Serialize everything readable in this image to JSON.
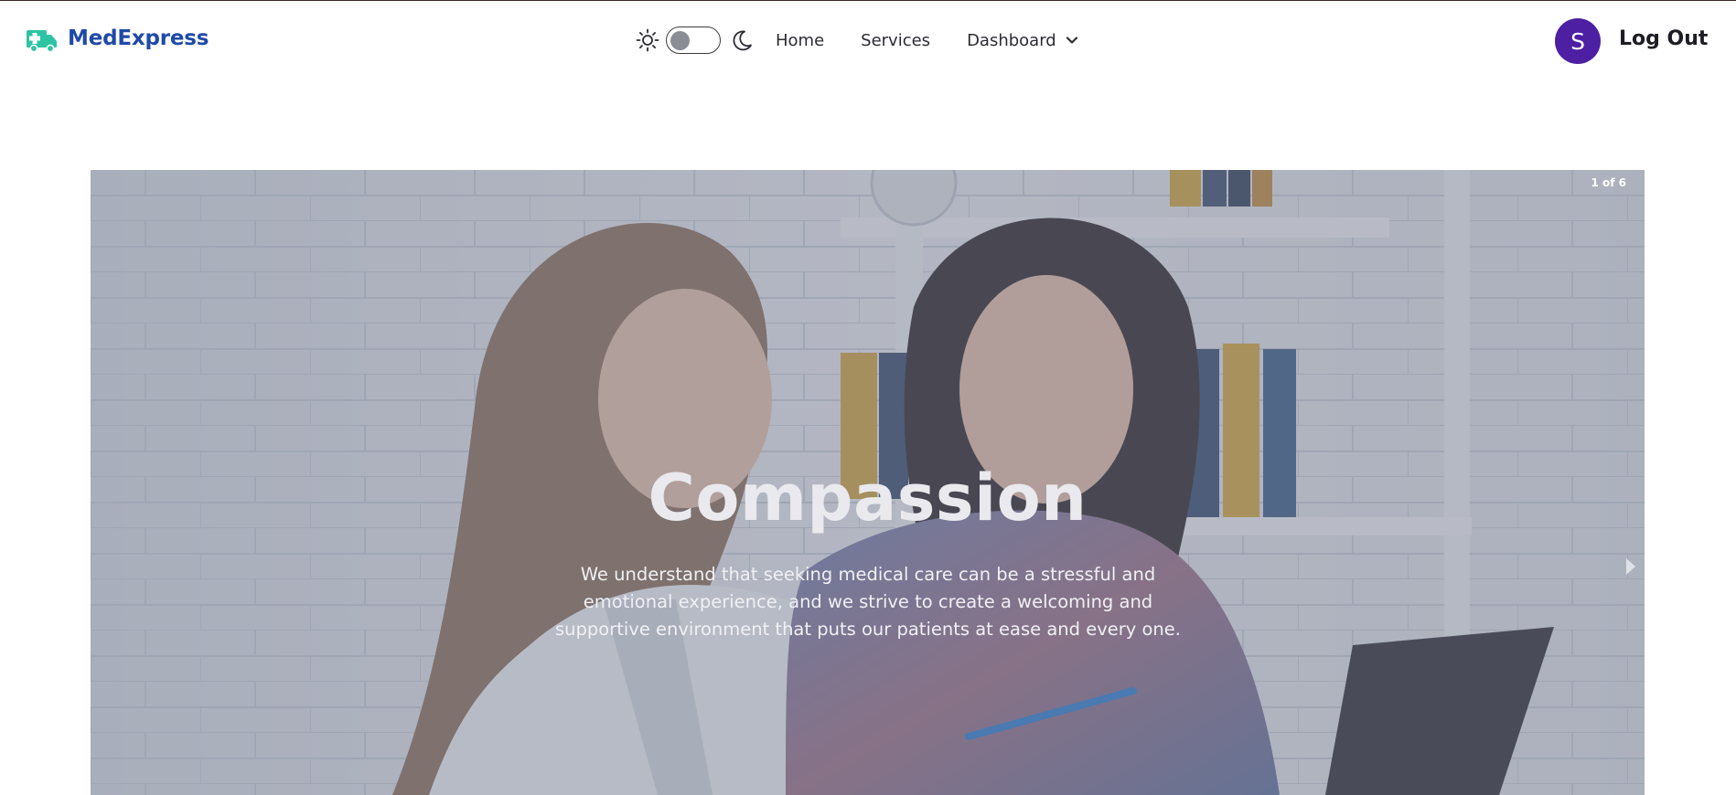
{
  "header": {
    "brand_name": "MedExpress",
    "nav": {
      "home_label": "Home",
      "services_label": "Services",
      "dashboard_label": "Dashboard"
    },
    "theme_toggle": {
      "state": "light"
    },
    "user": {
      "avatar_initial": "S",
      "logout_label": "Log Out"
    }
  },
  "carousel": {
    "counter": "1 of 6",
    "title": "Compassion",
    "text": "We understand that seeking medical care can be a stressful and emotional experience, and we strive to create a welcoming and supportive environment that puts our patients at ease and every one."
  },
  "colors": {
    "brand_blue": "#1f4aa8",
    "brand_teal": "#2ec4a3",
    "avatar_purple": "#4d1fa3"
  },
  "icons": [
    "ambulance-logo-icon",
    "sun-icon",
    "moon-icon",
    "chevron-down-icon",
    "next-arrow-icon"
  ]
}
